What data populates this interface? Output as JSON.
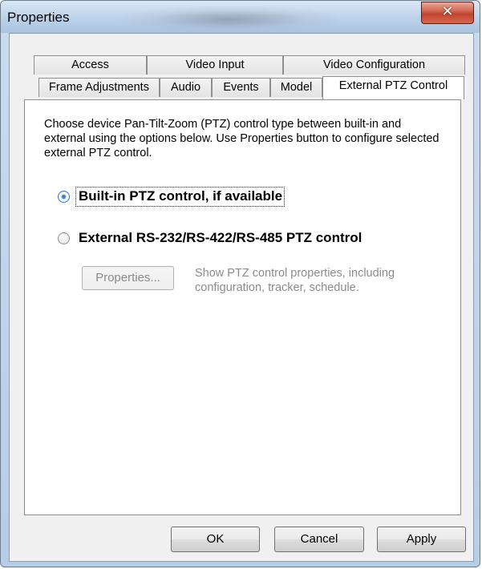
{
  "window": {
    "title": "Properties",
    "close_glyph": "✕"
  },
  "tabs": {
    "row1": [
      "Access",
      "Video Input",
      "Video Configuration"
    ],
    "row2": [
      "Frame Adjustments",
      "Audio",
      "Events",
      "Model",
      "External PTZ Control"
    ],
    "active": "External PTZ Control"
  },
  "content": {
    "description": "Choose device Pan-Tilt-Zoom (PTZ) control type between built-in and external using the options below. Use Properties button to configure selected external PTZ control.",
    "option_builtin": {
      "label": "Built-in PTZ control, if available",
      "checked": true
    },
    "option_external": {
      "label": "External RS-232/RS-422/RS-485 PTZ control",
      "checked": false
    },
    "properties_button": "Properties...",
    "properties_hint": "Show PTZ control properties, including configuration, tracker, schedule."
  },
  "footer": {
    "ok": "OK",
    "cancel": "Cancel",
    "apply": "Apply"
  },
  "colors": {
    "title_bar": "#bcd2ea",
    "close_button": "#c9503a",
    "radio_selected": "#2a74d8",
    "disabled_text": "#8b8b8b"
  }
}
